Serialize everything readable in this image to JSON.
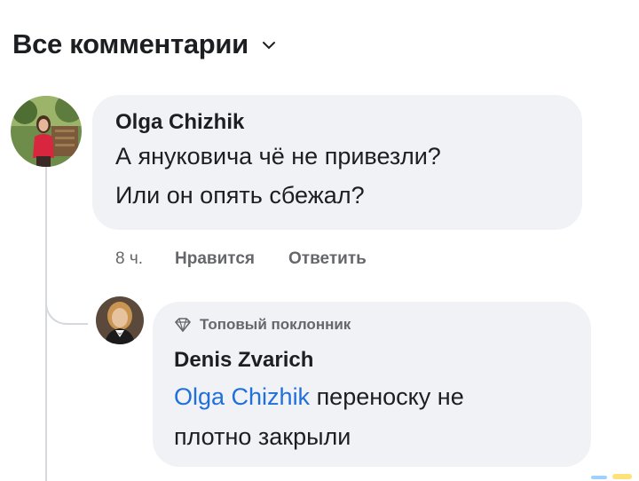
{
  "header": {
    "title": "Все комментарии"
  },
  "comments": [
    {
      "author": "Olga Chizhik",
      "lines": [
        "А януковича чё не привезли?",
        "Или он опять сбежал?"
      ],
      "time": "8 ч.",
      "like_label": "Нравится",
      "reply_label": "Ответить",
      "avatar_icon": "profile-photo"
    }
  ],
  "reply": {
    "badge": "Топовый поклонник",
    "badge_icon": "diamond-icon",
    "author": "Denis Zvarich",
    "mention": "Olga Chizhik",
    "line1_rest": " переноску не",
    "line2": "плотно закрыли",
    "avatar_icon": "profile-photo"
  },
  "colors": {
    "bubble": "#f0f2f5",
    "mention": "#216fdb",
    "secondary_text": "#65676b"
  }
}
